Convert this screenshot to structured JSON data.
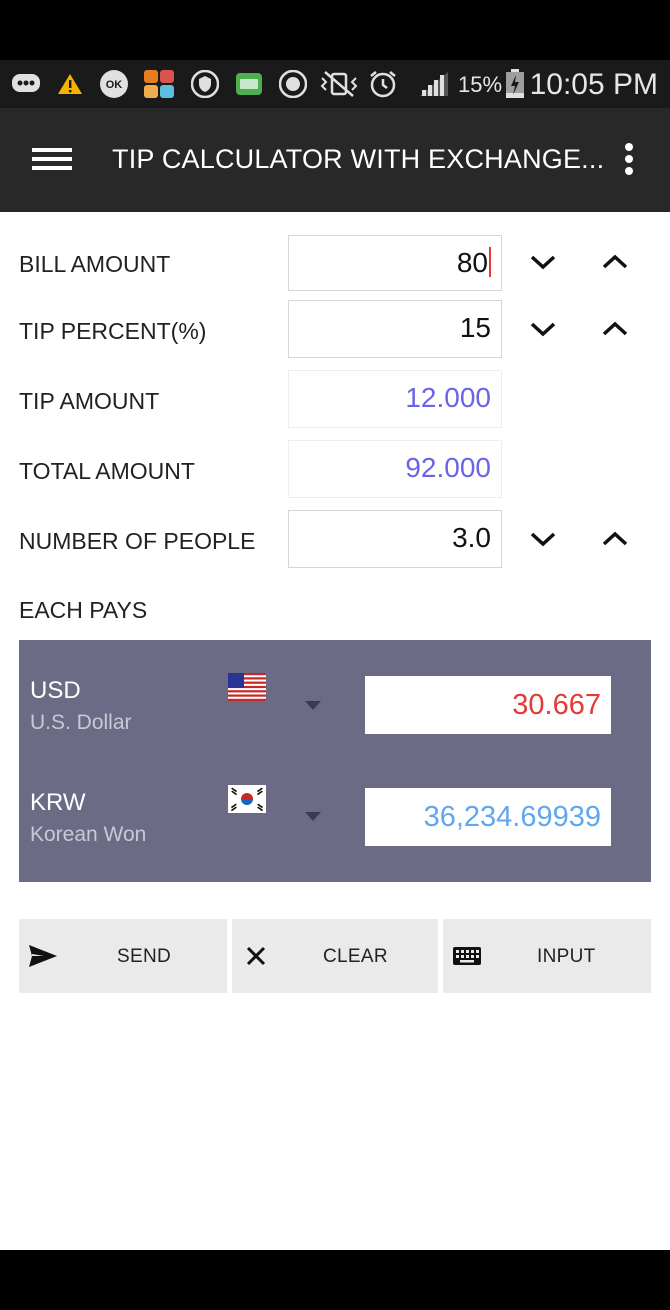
{
  "status_bar": {
    "battery_percent": "15%",
    "time": "10:05 PM",
    "icons": [
      "chat-icon",
      "warning-icon",
      "ok-cashbag-icon",
      "money-app-icon",
      "vpn-icon",
      "keyboard-icon",
      "cai-icon",
      "vibrate-icon",
      "alarm-icon",
      "signal-icon",
      "battery-icon"
    ],
    "ok_badge": "OK"
  },
  "app_bar": {
    "title": "TIP CALCULATOR WITH EXCHANGE..."
  },
  "form": {
    "bill_amount": {
      "label": "BILL AMOUNT",
      "value": "80"
    },
    "tip_percent": {
      "label": "TIP PERCENT(%)",
      "value": "15"
    },
    "tip_amount": {
      "label": "TIP AMOUNT",
      "value": "12.000"
    },
    "total_amount": {
      "label": "TOTAL AMOUNT",
      "value": "92.000"
    },
    "number_of_people": {
      "label": "NUMBER OF PEOPLE",
      "value": "3.0"
    }
  },
  "each_pays": {
    "label": "EACH PAYS",
    "currencies": [
      {
        "code": "USD",
        "name": "U.S. Dollar",
        "value": "30.667",
        "color": "#e53935"
      },
      {
        "code": "KRW",
        "name": "Korean Won",
        "value": "36,234.69939",
        "color": "#5fa8ee"
      }
    ]
  },
  "actions": {
    "send": "SEND",
    "clear": "CLEAR",
    "input": "INPUT"
  },
  "colors": {
    "app_bar": "#282828",
    "currency_panel": "#6b6b86",
    "computed_value": "#6b63e8",
    "button_bg": "#eaeaea"
  }
}
